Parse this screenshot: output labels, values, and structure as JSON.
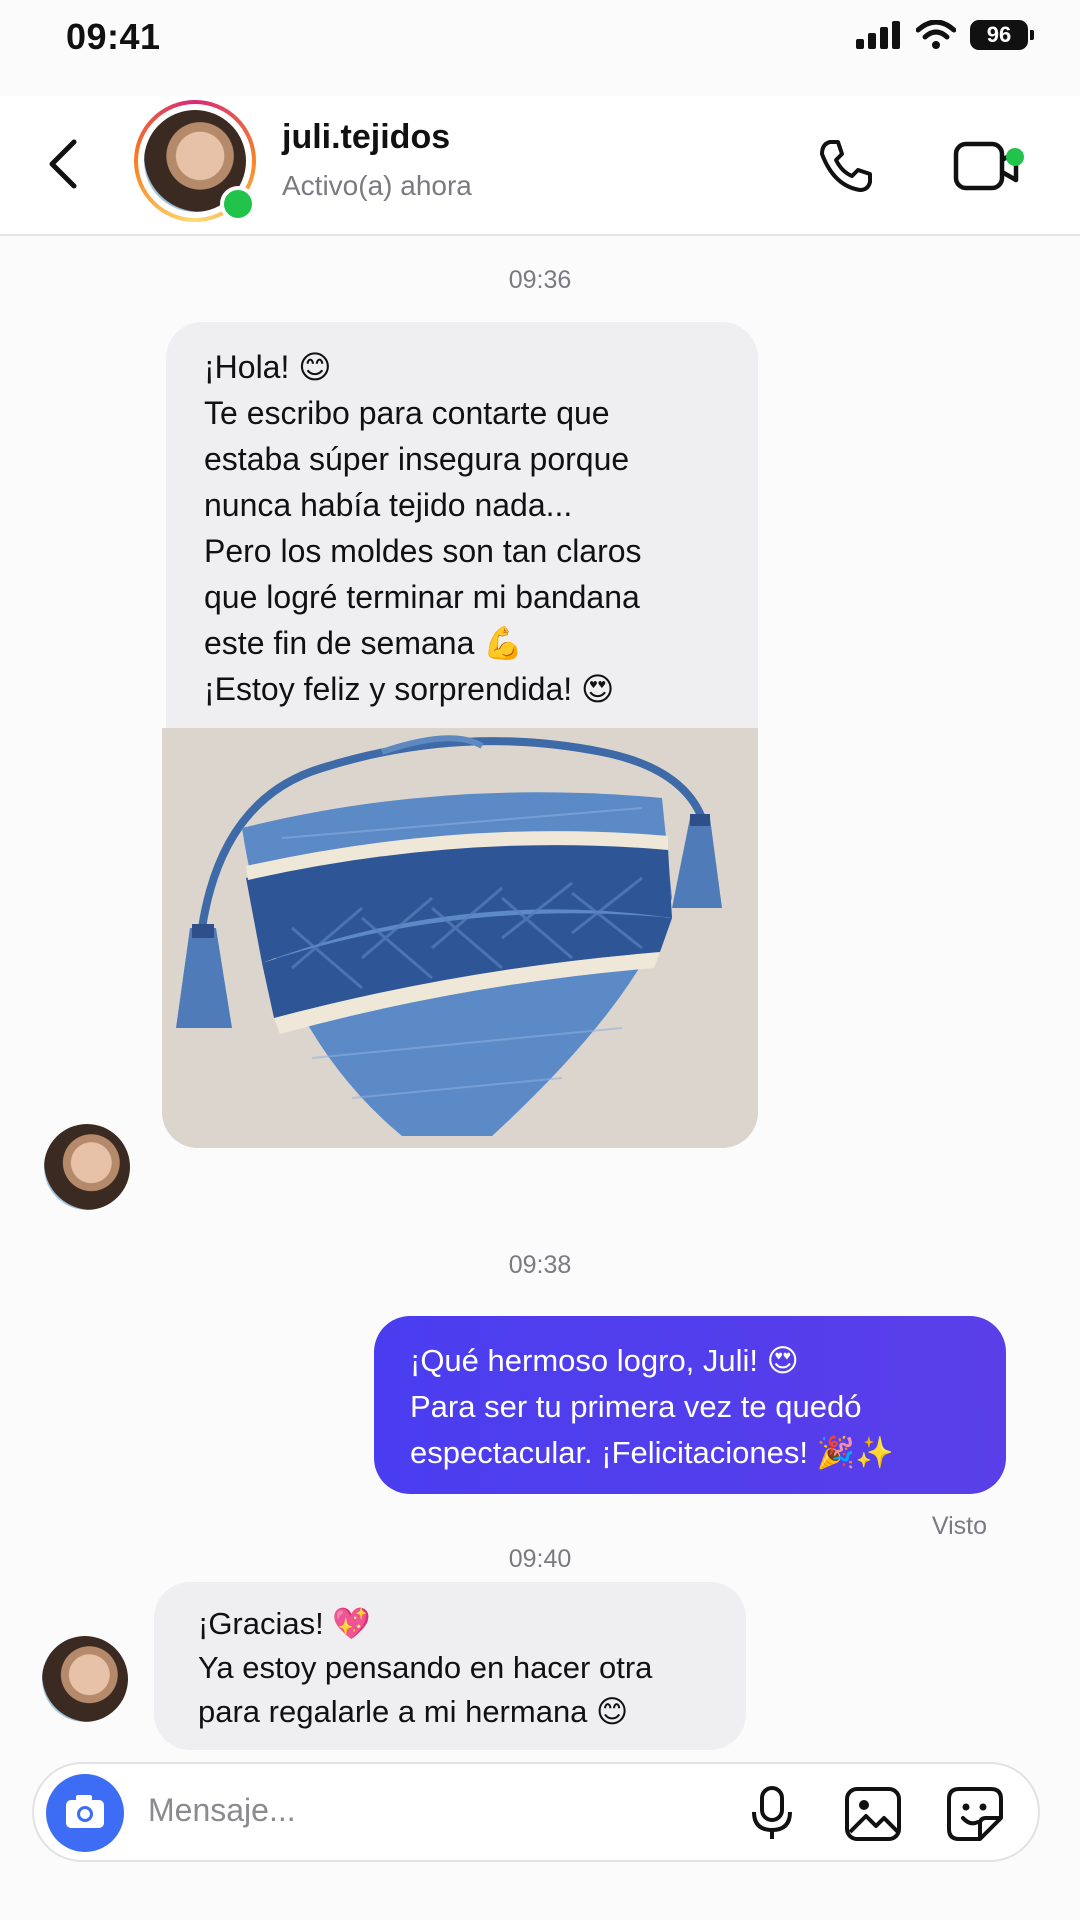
{
  "status_bar": {
    "time": "09:41",
    "battery": "96"
  },
  "header": {
    "username": "juli.tejidos",
    "status": "Activo(a) ahora",
    "icons": [
      "back-chevron-icon",
      "phone-icon",
      "video-icon"
    ]
  },
  "messages": {
    "timestamp_1": "09:36",
    "msg1_lines": [
      "¡Hola! 😊",
      "Te escribo para contarte que",
      "estaba súper insegura porque",
      "nunca había tejido nada...",
      "Pero los moldes son tan claros",
      "que logré terminar mi bandana",
      "este fin de semana 💪",
      "¡Estoy feliz y sorprendida! 😍"
    ],
    "timestamp_2": "09:38",
    "reply_lines": [
      "¡Qué hermoso logro, Juli! 😍",
      "Para ser tu primera vez te quedó",
      "espectacular. ¡Felicitaciones! 🎉✨"
    ],
    "seen": "Visto",
    "timestamp_3": "09:40",
    "msg3_lines": [
      "¡Gracias! 💖",
      "Ya estoy pensando en hacer otra",
      "para regalarle a mi hermana 😊"
    ]
  },
  "composer": {
    "placeholder": "Mensaje...",
    "icons": [
      "camera-icon",
      "microphone-icon",
      "gallery-icon",
      "sticker-icon"
    ]
  },
  "colors": {
    "accent": "#4a3df0",
    "online": "#22c34b",
    "camera": "#3d6df5"
  }
}
